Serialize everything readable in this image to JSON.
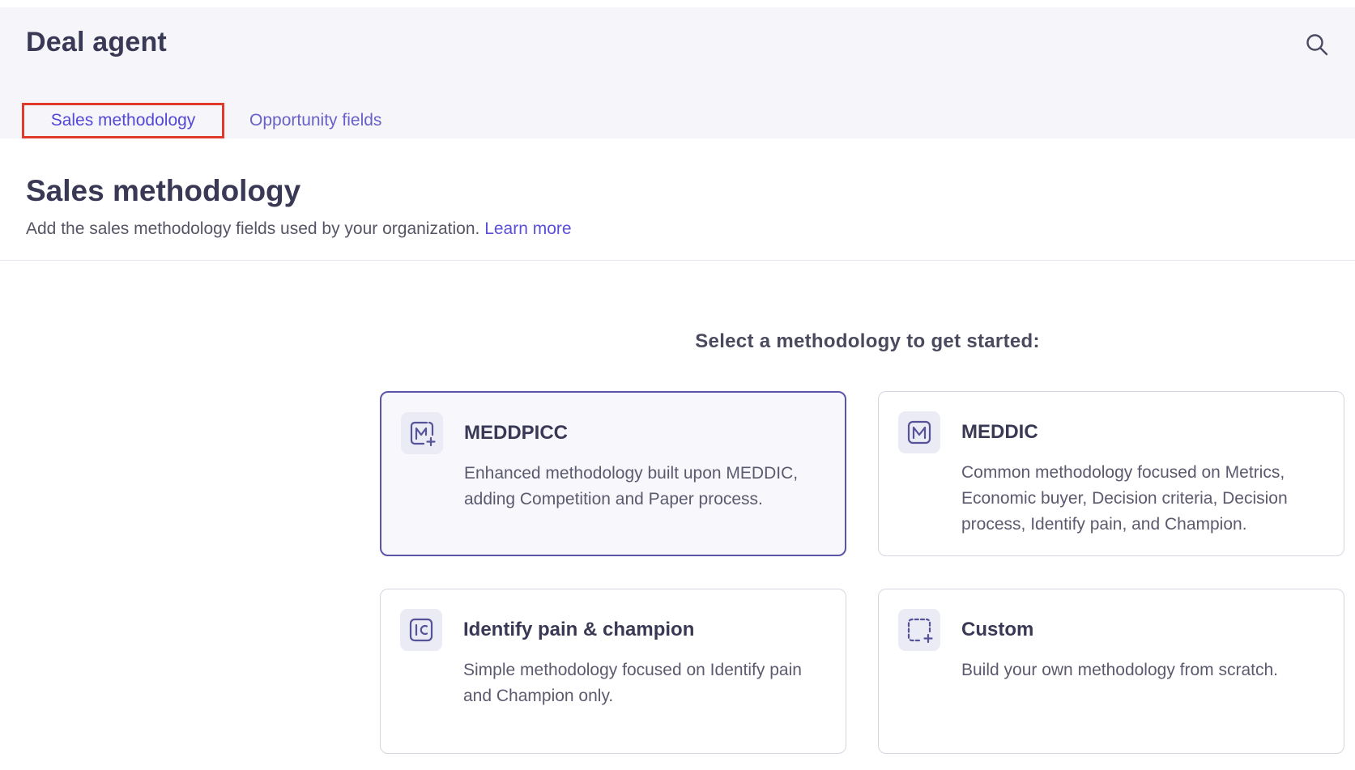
{
  "app": {
    "title": "Deal agent"
  },
  "tabs": [
    {
      "label": "Sales methodology",
      "active": true
    },
    {
      "label": "Opportunity fields",
      "active": false
    }
  ],
  "section": {
    "title": "Sales methodology",
    "description": "Add the sales methodology fields used by your organization.",
    "link_label": "Learn more"
  },
  "prompt": "Select a methodology to get started:",
  "cards": [
    {
      "icon": "meddpicc-icon",
      "title": "MEDDPICC",
      "description": "Enhanced methodology built upon MEDDIC, adding Competition and Paper process.",
      "selected": true
    },
    {
      "icon": "meddic-icon",
      "title": "MEDDIC",
      "description": "Common methodology focused on Metrics, Economic buyer, Decision criteria, Decision process, Identify pain, and Champion.",
      "selected": false
    },
    {
      "icon": "identify-pain-champion-icon",
      "title": "Identify pain & champion",
      "description": "Simple methodology focused on Identify pain and Champion only.",
      "selected": false
    },
    {
      "icon": "custom-icon",
      "title": "Custom",
      "description": "Build your own methodology from scratch.",
      "selected": false
    }
  ],
  "colors": {
    "accent": "#5448d6",
    "highlight_border": "#e03a2a",
    "header_bg": "#f6f6fa",
    "selected_card_border": "#5a55a8",
    "icon_bg": "#ebebf5"
  }
}
